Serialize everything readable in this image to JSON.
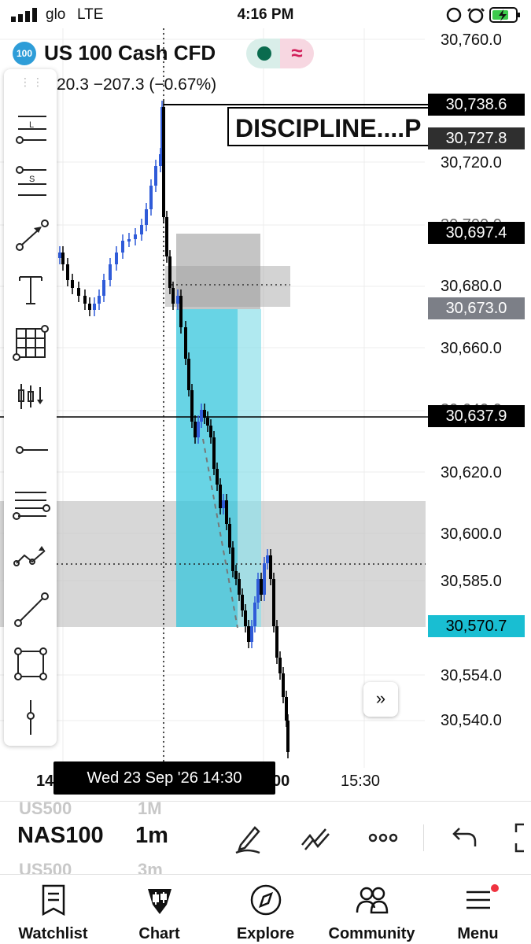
{
  "status_bar": {
    "carrier": "glo",
    "network": "LTE",
    "time": "4:16 PM"
  },
  "header": {
    "symbol_badge": "100",
    "symbol_title": "US 100 Cash CFD",
    "change_text": "20.3  −207.3 (−0.67%)",
    "pill_right": "≈"
  },
  "price_axis": [
    "30,760.0",
    "30,720.0",
    "30,680.0",
    "30,660.0",
    "30,620.0",
    "30,600.0",
    "30,585.0",
    "30,554.0",
    "30,540.0"
  ],
  "price_tags": {
    "high": "30,738.6",
    "text_level": "30,727.8",
    "zone_top": "30,697.4",
    "entry": "30,673.0",
    "crosshair": "30,637.9",
    "target": "30,570.7"
  },
  "colors": {
    "accent_cyan": "#19bed2",
    "crosshair_tag": "#000000",
    "grey_tag": "#7c7f87",
    "candle_up": "#2f5bd8",
    "candle_down": "#000000"
  },
  "chart_text": {
    "note": "DISCIPLINE....P"
  },
  "time_axis": {
    "left_label": "14",
    "right_partial": "00",
    "right_label": "15:30",
    "crosshair_date": "Wed 23 Sep '26   14:30"
  },
  "toolbar": {
    "grip_icon": "drag-handle-icon",
    "items": [
      "long-position-icon",
      "short-position-icon",
      "arrow-line-icon",
      "text-icon",
      "grid-table-icon",
      "candles-icon",
      "horizontal-ray-icon",
      "parallel-lines-icon",
      "path-icon",
      "trend-line-icon",
      "rectangle-icon",
      "vertical-line-icon"
    ],
    "forward_icon": "double-chevron-right-icon"
  },
  "symbol_strip": {
    "ghost_top_symbol": "US500",
    "ghost_top_tf": "1M",
    "symbol": "NAS100",
    "timeframe": "1m",
    "ghost_bottom_symbol": "US500",
    "ghost_bottom_tf": "3m",
    "icons": [
      "pen-icon",
      "chart-drawing-icon",
      "more-icon",
      "undo-icon",
      "fullscreen-icon"
    ]
  },
  "bottom_nav": [
    {
      "label": "Watchlist",
      "icon": "watchlist-icon"
    },
    {
      "label": "Chart",
      "icon": "chart-icon"
    },
    {
      "label": "Explore",
      "icon": "compass-icon"
    },
    {
      "label": "Community",
      "icon": "community-icon"
    },
    {
      "label": "Menu",
      "icon": "menu-icon"
    }
  ]
}
